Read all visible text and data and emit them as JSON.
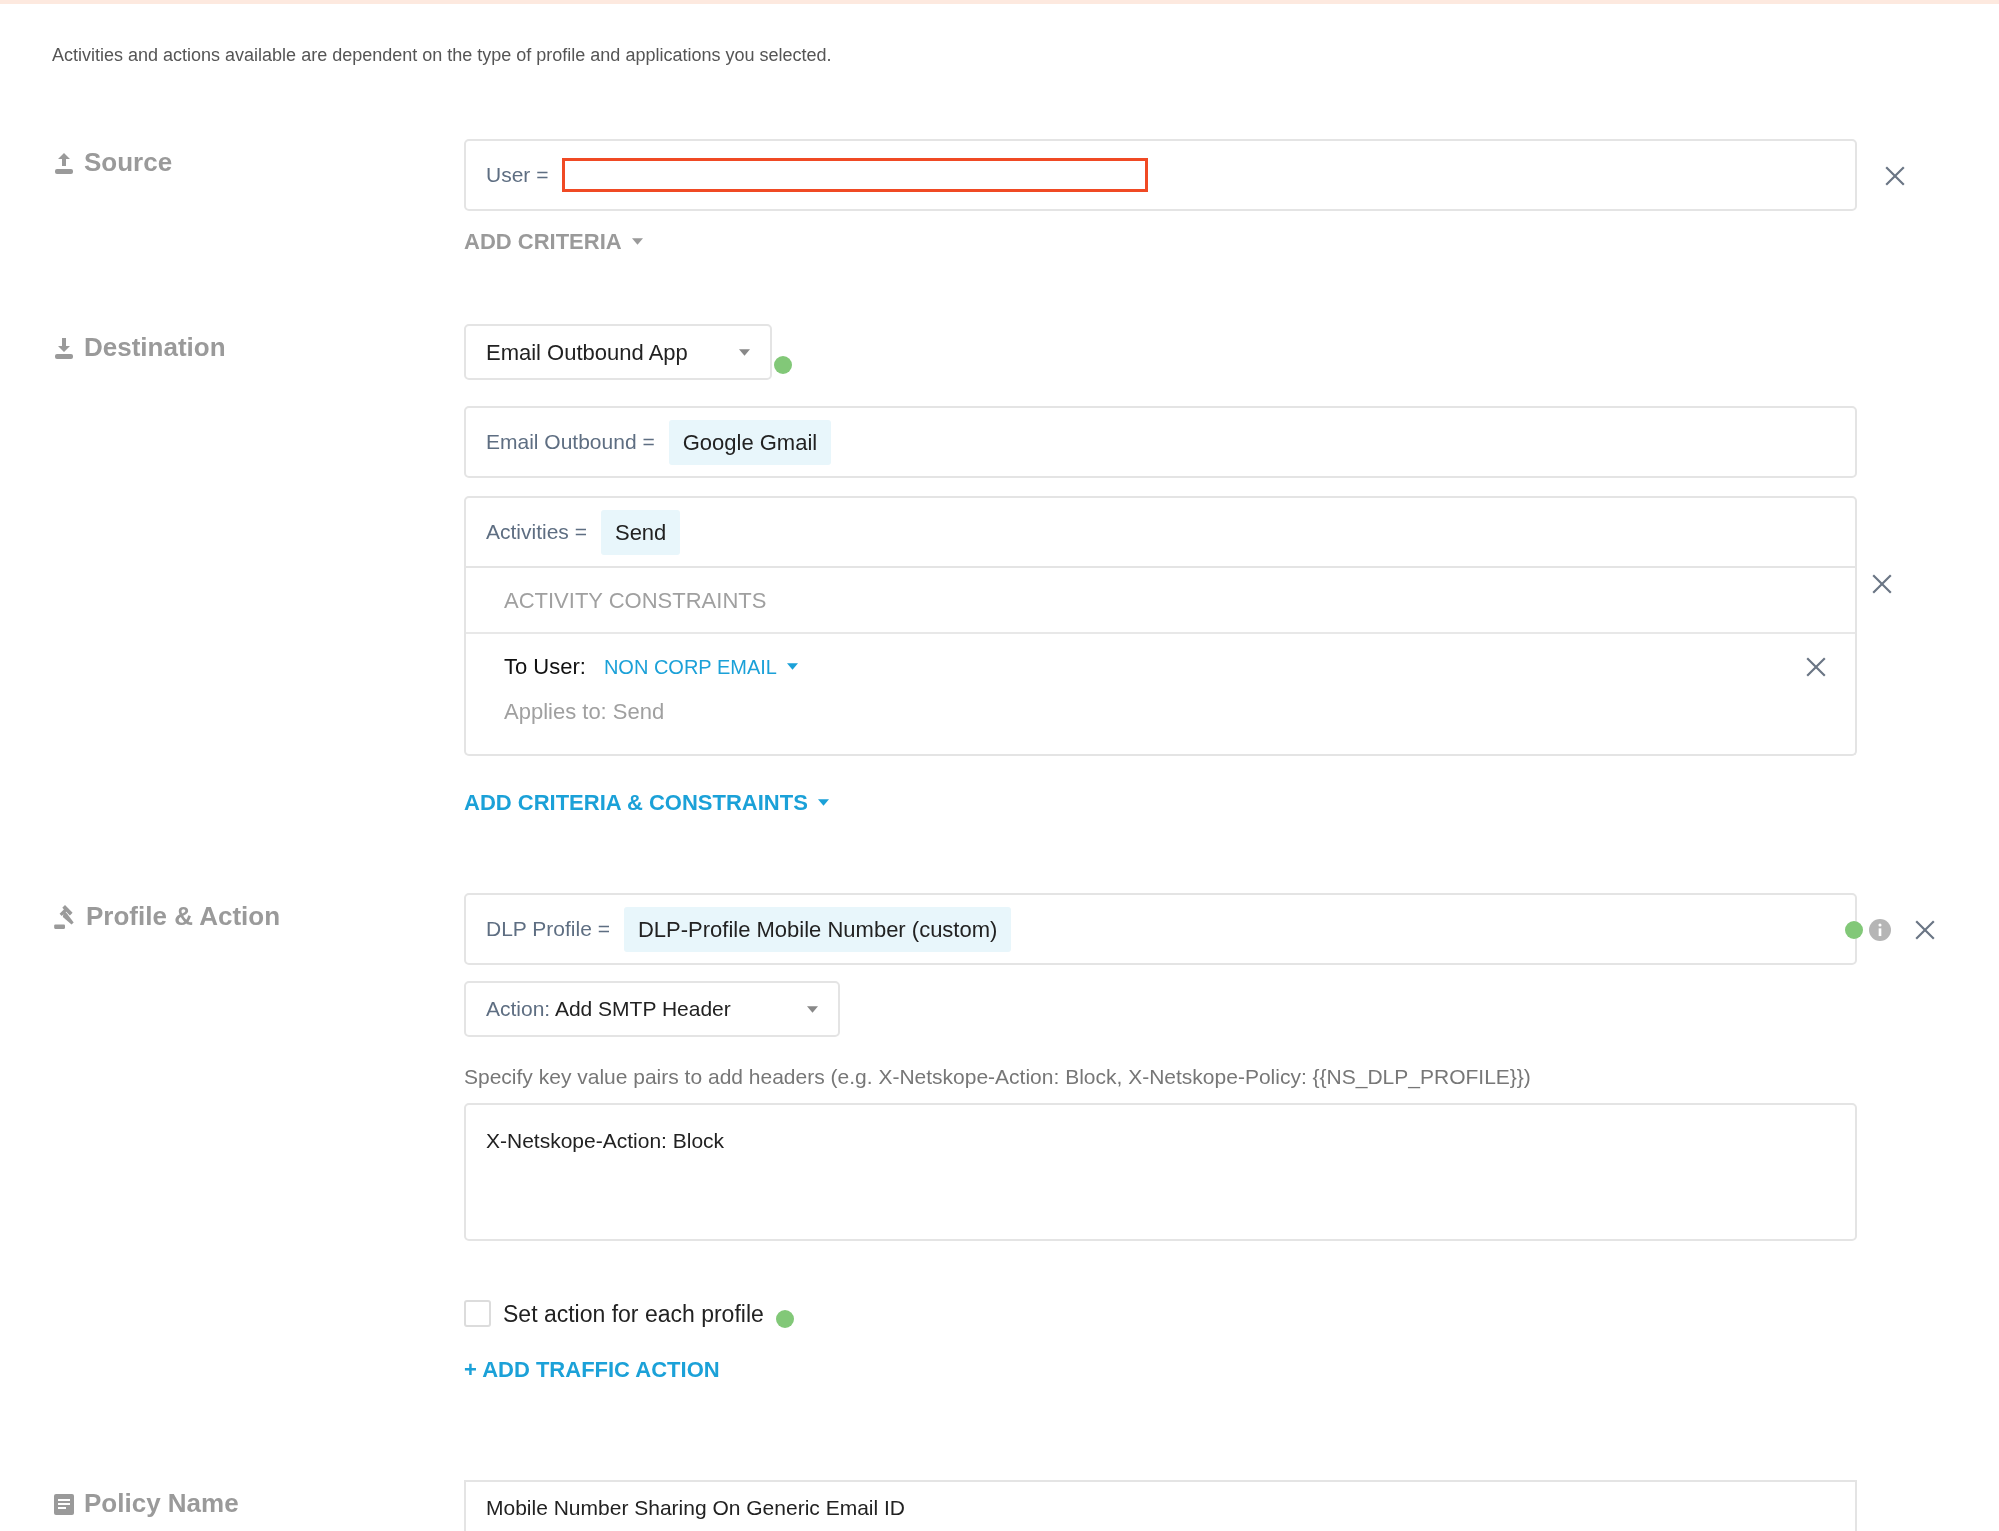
{
  "intro": "Activities and actions available are dependent on the type of profile and applications you selected.",
  "source": {
    "title": "Source",
    "user_field": {
      "label": "User =",
      "redacted": true
    },
    "add_criteria": "ADD CRITERIA"
  },
  "destination": {
    "title": "Destination",
    "app_select": "Email Outbound App",
    "criteria": [
      {
        "label": "Email Outbound =",
        "value": "Google Gmail"
      },
      {
        "label": "Activities =",
        "value": "Send"
      }
    ],
    "constraints": {
      "heading": "ACTIVITY CONSTRAINTS",
      "items": [
        {
          "label": "To User:",
          "value": "NON CORP EMAIL",
          "applies": "Applies to: Send"
        }
      ]
    },
    "add_link": "ADD CRITERIA & CONSTRAINTS"
  },
  "profile_action": {
    "title": "Profile & Action",
    "profile": {
      "label": "DLP Profile =",
      "value": "DLP-Profile Mobile Number (custom)"
    },
    "action": {
      "label": "Action:",
      "value": "Add SMTP Header"
    },
    "hint": "Specify key value pairs to add headers (e.g. X-Netskope-Action: Block, X-Netskope-Policy: {{NS_DLP_PROFILE}})",
    "headers": "X-Netskope-Action: Block",
    "per_profile": {
      "label": "Set action for each profile",
      "checked": false
    },
    "add_traffic": "+ ADD TRAFFIC ACTION"
  },
  "policy_name": {
    "title": "Policy Name",
    "value": "Mobile Number Sharing On Generic Email ID"
  }
}
